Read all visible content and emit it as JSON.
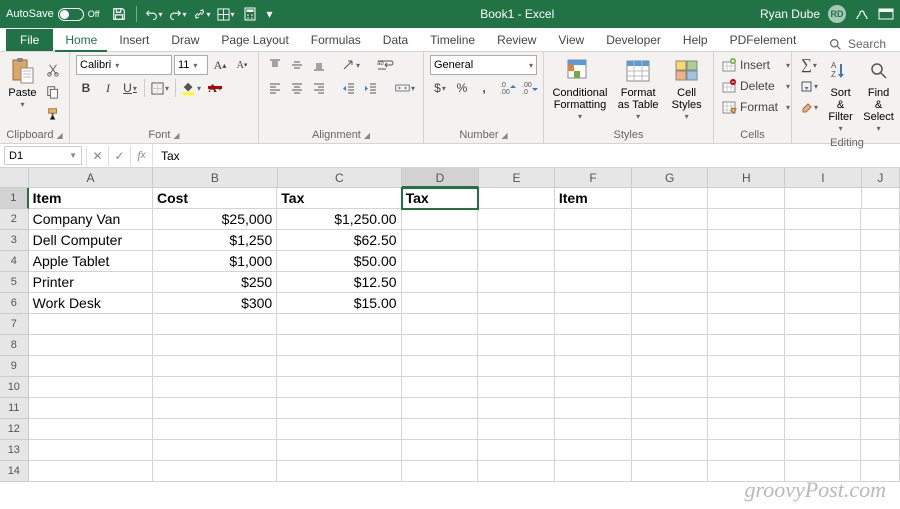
{
  "titlebar": {
    "autosave_label": "AutoSave",
    "autosave_state": "Off",
    "title": "Book1  -  Excel",
    "user_name": "Ryan Dube",
    "user_initials": "RD"
  },
  "menu": {
    "tabs": [
      "File",
      "Home",
      "Insert",
      "Draw",
      "Page Layout",
      "Formulas",
      "Data",
      "Timeline",
      "Review",
      "View",
      "Developer",
      "Help",
      "PDFelement"
    ],
    "active": "Home",
    "search_placeholder": "Search"
  },
  "ribbon": {
    "clipboard": {
      "label": "Clipboard",
      "paste": "Paste"
    },
    "font": {
      "label": "Font",
      "name": "Calibri",
      "size": "11",
      "bold": "B",
      "italic": "I",
      "underline": "U"
    },
    "alignment": {
      "label": "Alignment"
    },
    "number": {
      "label": "Number",
      "format": "General"
    },
    "styles": {
      "label": "Styles",
      "conditional": "Conditional Formatting",
      "table": "Format as Table",
      "cell": "Cell Styles"
    },
    "cells": {
      "label": "Cells",
      "insert": "Insert",
      "delete": "Delete",
      "format": "Format"
    },
    "editing": {
      "label": "Editing",
      "sort": "Sort & Filter",
      "find": "Find & Select"
    }
  },
  "formula_bar": {
    "name_box": "D1",
    "formula": "Tax"
  },
  "grid": {
    "col_widths": {
      "A": 130,
      "B": 130,
      "C": 130,
      "D": 80,
      "E": 80,
      "F": 80,
      "G": 80,
      "H": 80,
      "I": 80,
      "J": 40
    },
    "columns": [
      "A",
      "B",
      "C",
      "D",
      "E",
      "F",
      "G",
      "H",
      "I",
      "J"
    ],
    "selected_cell": "D1",
    "row_count": 14,
    "data": {
      "1": {
        "A": "Item",
        "B": "Cost",
        "C": "Tax",
        "D": "Tax",
        "F": "Item"
      },
      "2": {
        "A": "Company Van",
        "B": "$25,000",
        "C": "$1,250.00"
      },
      "3": {
        "A": "Dell Computer",
        "B": "$1,250",
        "C": "$62.50"
      },
      "4": {
        "A": "Apple Tablet",
        "B": "$1,000",
        "C": "$50.00"
      },
      "5": {
        "A": "Printer",
        "B": "$250",
        "C": "$12.50"
      },
      "6": {
        "A": "Work Desk",
        "B": "$300",
        "C": "$15.00"
      }
    }
  },
  "watermark": "groovyPost.com"
}
